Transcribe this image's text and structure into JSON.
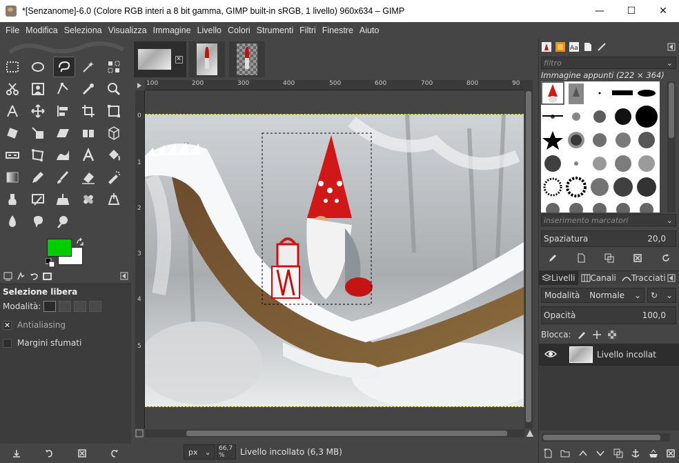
{
  "window": {
    "title": "*[Senzanome]-6.0 (Colore RGB interi a 8 bit gamma, GIMP built-in sRGB, 1 livello) 960x634 – GIMP",
    "minimize_label": "—",
    "maximize_label": "☐",
    "close_label": "✕"
  },
  "menu": {
    "items": [
      "File",
      "Modifica",
      "Seleziona",
      "Visualizza",
      "Immagine",
      "Livello",
      "Colori",
      "Strumenti",
      "Filtri",
      "Finestre",
      "Aiuto"
    ]
  },
  "toolbox": {
    "active_tool": "free-select-tool",
    "fg_color": "#00cc00",
    "bg_color": "#ffffff"
  },
  "tool_options": {
    "title": "Selezione libera",
    "mode_label": "Modalità:",
    "antialiasing_label": "Antialiasing",
    "antialiasing_checked": true,
    "feather_label": "Margini sfumati",
    "feather_checked": false
  },
  "rulers": {
    "horizontal": [
      "100",
      "200",
      "300",
      "400",
      "500",
      "600",
      "700",
      "800",
      "90"
    ],
    "vertical": [
      "0",
      "1",
      "2",
      "3",
      "4",
      "5"
    ]
  },
  "status": {
    "unit": "px",
    "zoom": "66,7 %",
    "text": "Livello incollato (6,3 MB)"
  },
  "brushes": {
    "filter_placeholder": "filtro",
    "caption": "Immagine appunti (222 × 364)",
    "tag_placeholder": "inserimento marcatori",
    "spacing_label": "Spaziatura",
    "spacing_value": "20,0"
  },
  "layers": {
    "tabs": [
      "Livelli",
      "Canali",
      "Tracciati"
    ],
    "mode_label": "Modalità",
    "mode_value": "Normale",
    "opacity_label": "Opacità",
    "opacity_value": "100,0",
    "lock_label": "Blocca:",
    "items": [
      {
        "name": "Livello incollat",
        "visible": true
      }
    ]
  }
}
